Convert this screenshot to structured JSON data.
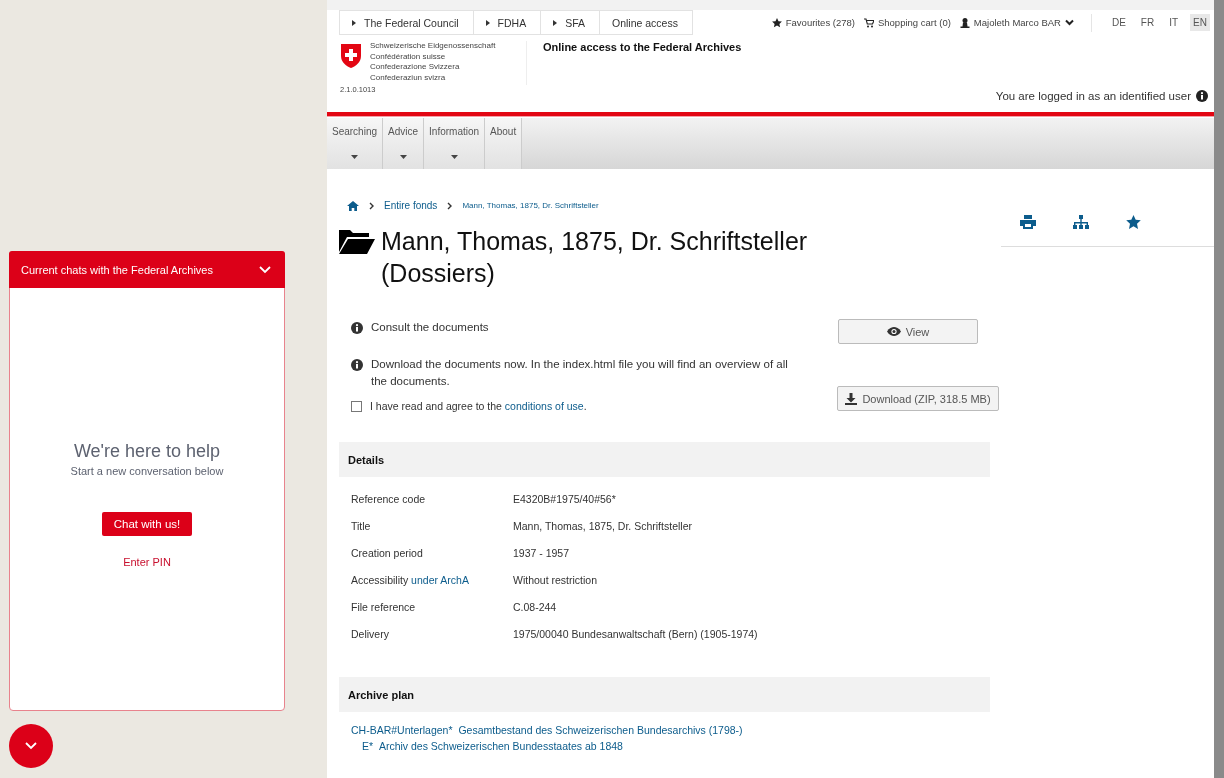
{
  "top_bar": {
    "crumbs": [
      "The Federal Council",
      "FDHA",
      "SFA",
      "Online access"
    ],
    "favourites": "Favourites (278)",
    "cart": "Shopping cart (0)",
    "user": "Majoleth Marco BAR",
    "languages": [
      {
        "label": "DE",
        "selected": false
      },
      {
        "label": "FR",
        "selected": false
      },
      {
        "label": "IT",
        "selected": false
      },
      {
        "label": "EN",
        "selected": true
      }
    ]
  },
  "header": {
    "names": [
      "Schweizerische Eidgenossenschaft",
      "Confédération suisse",
      "Confederazione Svizzera",
      "Confederaziun svizra"
    ],
    "version": "2.1.0.1013",
    "site_title": "Online access to the Federal Archives",
    "login_status": "You are logged in as an identified user"
  },
  "main_nav": [
    {
      "label": "Searching",
      "dropdown": true
    },
    {
      "label": "Advice",
      "dropdown": true
    },
    {
      "label": "Information",
      "dropdown": true
    },
    {
      "label": "About",
      "dropdown": false
    }
  ],
  "breadcrumb": [
    "Entire fonds",
    "Mann, Thomas, 1875, Dr. Schriftsteller"
  ],
  "title": "Mann, Thomas, 1875, Dr. Schriftsteller (Dossiers)",
  "actions": {
    "consult_text": "Consult the documents",
    "view_button": "View",
    "download_text": "Download the documents now. In the index.html file you will find an overview of all the documents.",
    "agree": {
      "before": "I have read and agree to the ",
      "link": "conditions of use",
      "after": ".",
      "checked": false
    },
    "download_button": "Download (ZIP, 318.5 MB)"
  },
  "details": {
    "heading": "Details",
    "rows": [
      {
        "label": "Reference code",
        "value": "E4320B#1975/40#56*"
      },
      {
        "label": "Title",
        "value": "Mann, Thomas, 1875, Dr. Schriftsteller"
      },
      {
        "label": "Creation period",
        "value": "1937 - 1957"
      },
      {
        "label": "Accessibility",
        "label_link": "under ArchA",
        "value": "Without restriction"
      },
      {
        "label": "File reference",
        "value": "C.08-244"
      },
      {
        "label": "Delivery",
        "value": "1975/00040 Bundesanwaltschaft (Bern) (1905-1974)"
      }
    ]
  },
  "archive_plan": {
    "heading": "Archive plan",
    "items": [
      {
        "code": "CH-BAR#Unterlagen*",
        "text": "Gesamtbestand des Schweizerischen Bundesarchivs (1798-)",
        "children": [
          {
            "code": "E*",
            "text": "Archiv des Schweizerischen Bundesstaates ab 1848"
          }
        ]
      }
    ]
  },
  "chat": {
    "title": "Current chats with the Federal Archives",
    "heading": "We're here to help",
    "subheading": "Start a new conversation below",
    "button": "Chat with us!",
    "pin_link": "Enter PIN"
  }
}
